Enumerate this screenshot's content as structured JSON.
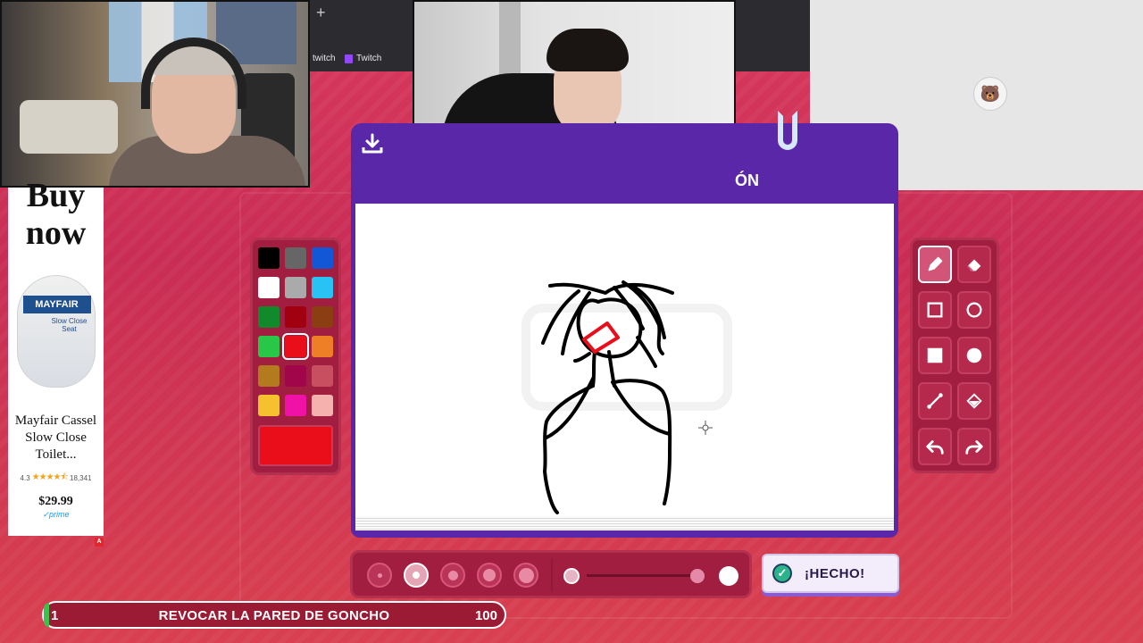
{
  "browser": {
    "new_tab_symbol": "+",
    "tab_1": "twitch",
    "tab_2": "Twitch"
  },
  "ad": {
    "headline": "Buy now",
    "brand": "MAYFAIR",
    "brand_subtitle": "Slow Close Seat",
    "product_name": "Mayfair Cassel Slow Close Toilet...",
    "rating": "4.3",
    "stars": "★★★★⯪",
    "review_count": "18,341",
    "price": "$29.99",
    "prime": "✓prime",
    "badge": "A"
  },
  "palette": {
    "colors": [
      "#000000",
      "#666666",
      "#1257d6",
      "#ffffff",
      "#aaaaaa",
      "#29c2f5",
      "#118a2b",
      "#a0000f",
      "#8a3e12",
      "#28c747",
      "#ea0e1a",
      "#ef7f27",
      "#b47a1e",
      "#a1064a",
      "#c74f5f",
      "#f5c12e",
      "#f011a6",
      "#f4b1ae"
    ],
    "selected_index": 10,
    "current_color": "#ea0e1a"
  },
  "drawing_panel": {
    "header_text": "ÓN",
    "icons": {
      "download": "download-icon",
      "cursor": "crosshair-icon"
    }
  },
  "tools": [
    {
      "name": "pencil",
      "icon": "pencil-icon",
      "active": true
    },
    {
      "name": "eraser",
      "icon": "eraser-icon",
      "active": false
    },
    {
      "name": "rectangle",
      "icon": "square-outline-icon",
      "active": false
    },
    {
      "name": "ellipse",
      "icon": "circle-outline-icon",
      "active": false
    },
    {
      "name": "filled-rectangle",
      "icon": "square-filled-icon",
      "active": false
    },
    {
      "name": "filled-ellipse",
      "icon": "circle-filled-icon",
      "active": false
    },
    {
      "name": "line",
      "icon": "line-icon",
      "active": false
    },
    {
      "name": "fill-bucket",
      "icon": "paint-bucket-icon",
      "active": false
    },
    {
      "name": "undo",
      "icon": "undo-icon",
      "active": false
    },
    {
      "name": "redo",
      "icon": "redo-icon",
      "active": false
    }
  ],
  "brush": {
    "sizes": [
      1,
      2,
      3,
      4,
      5
    ],
    "selected_size_index": 1,
    "opacity_fraction": 0.95
  },
  "done_button": {
    "label": "¡HECHO!"
  },
  "goal": {
    "current": "1",
    "title": "REVOCAR LA PARED DE GONCHO",
    "target": "100",
    "progress_fraction": 0.01
  }
}
